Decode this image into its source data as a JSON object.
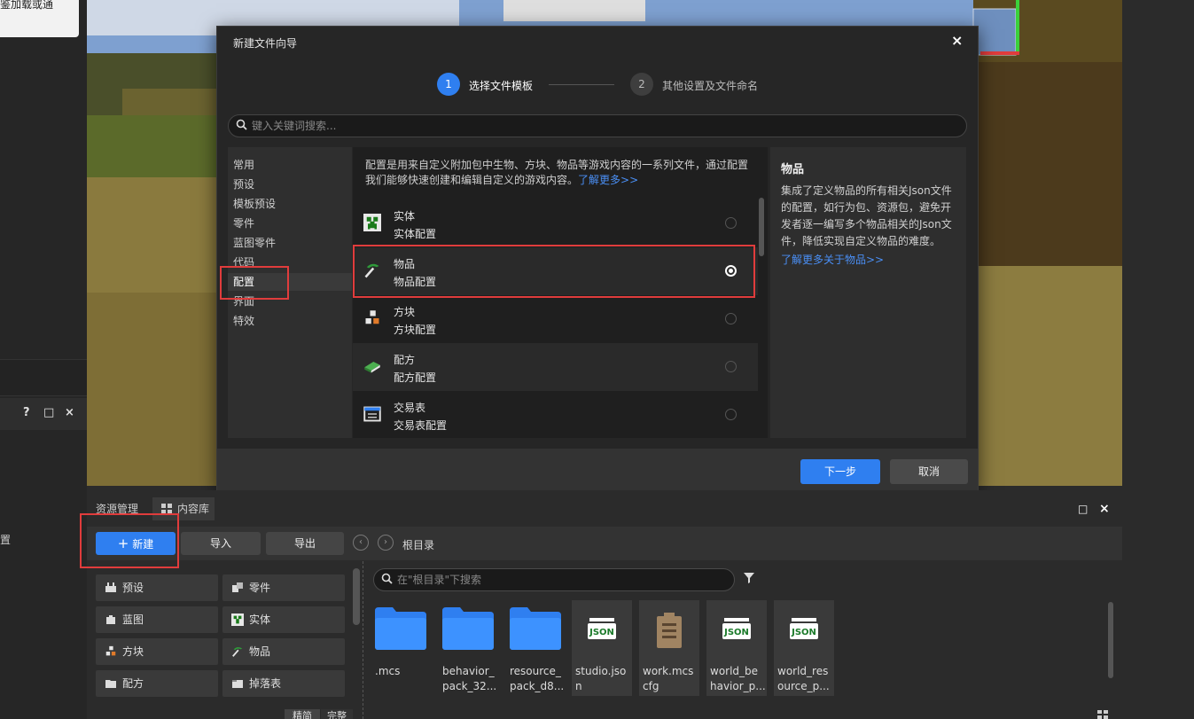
{
  "left": {
    "popup_text": "鉴加载或通",
    "panel_icons": [
      "?",
      "□",
      "×"
    ],
    "side_text": "置"
  },
  "modal": {
    "title": "新建文件向导",
    "close": "×",
    "steps": [
      {
        "num": "1",
        "label": "选择文件模板"
      },
      {
        "num": "2",
        "label": "其他设置及文件命名"
      }
    ],
    "search_placeholder": "键入关键词搜索...",
    "categories": [
      "常用",
      "预设",
      "模板预设",
      "零件",
      "蓝图零件",
      "代码",
      "配置",
      "界面",
      "特效"
    ],
    "selected_category": "配置",
    "description": "配置是用来自定义附加包中生物、方块、物品等游戏内容的一系列文件，通过配置我们能够快速创建和编辑自定义的游戏内容。",
    "description_link": "了解更多>>",
    "items": [
      {
        "title": "实体",
        "subtitle": "实体配置",
        "icon": "creeper-icon",
        "selected": false
      },
      {
        "title": "物品",
        "subtitle": "物品配置",
        "icon": "pickaxe-icon",
        "selected": true
      },
      {
        "title": "方块",
        "subtitle": "方块配置",
        "icon": "blocks-icon",
        "selected": false
      },
      {
        "title": "配方",
        "subtitle": "配方配置",
        "icon": "recipe-book-icon",
        "selected": false
      },
      {
        "title": "交易表",
        "subtitle": "交易表配置",
        "icon": "trade-table-icon",
        "selected": false
      }
    ],
    "info": {
      "title": "物品",
      "text": "集成了定义物品的所有相关Json文件的配置，如行为包、资源包，避免开发者逐一编写多个物品相关的Json文件，降低实现自定义物品的难度。",
      "link": "了解更多关于物品>>"
    },
    "next": "下一步",
    "cancel": "取消"
  },
  "bottom": {
    "tabs": [
      "资源管理",
      "内容库"
    ],
    "panel_icons": [
      "□",
      "×"
    ],
    "new_label": "新建",
    "import_label": "导入",
    "export_label": "导出",
    "breadcrumb": "根目录",
    "search_placeholder": "在\"根目录\"下搜索",
    "categories": [
      {
        "label": "预设",
        "icon": "preset-icon"
      },
      {
        "label": "零件",
        "icon": "part-icon"
      },
      {
        "label": "蓝图",
        "icon": "blueprint-icon"
      },
      {
        "label": "实体",
        "icon": "creeper-icon"
      },
      {
        "label": "方块",
        "icon": "blocks-icon"
      },
      {
        "label": "物品",
        "icon": "pickaxe-icon"
      },
      {
        "label": "配方",
        "icon": "folder-icon"
      },
      {
        "label": "掉落表",
        "icon": "loot-table-icon"
      }
    ],
    "bottom_tabs": [
      "精简",
      "完整"
    ],
    "files": [
      {
        "name": ".mcs",
        "type": "folder"
      },
      {
        "name": "behavior_pack_32...",
        "type": "folder"
      },
      {
        "name": "resource_pack_d8...",
        "type": "folder"
      },
      {
        "name": "studio.json",
        "type": "json"
      },
      {
        "name": "work.mcscfg",
        "type": "clipboard"
      },
      {
        "name": "world_behavior_p...",
        "type": "json"
      },
      {
        "name": "world_resource_p...",
        "type": "json"
      }
    ],
    "file_lines": [
      [
        ".mcs",
        ""
      ],
      [
        "behavior_",
        "pack_32..."
      ],
      [
        "resource_",
        "pack_d8..."
      ],
      [
        "studio.jso",
        "n"
      ],
      [
        "work.mcs",
        "cfg"
      ],
      [
        "world_be",
        "havior_p..."
      ],
      [
        "world_res",
        "ource_p..."
      ]
    ]
  },
  "colors": {
    "accent": "#2f7ff0",
    "highlight": "#e03c3c"
  }
}
